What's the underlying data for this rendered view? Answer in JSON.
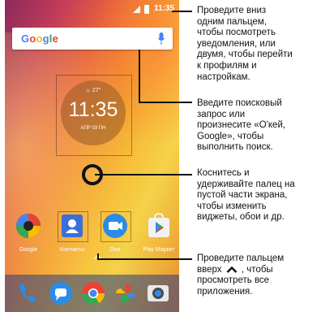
{
  "status": {
    "time": "11:35"
  },
  "search": {
    "logo": "Google"
  },
  "clock": {
    "weather": "☼ 27°",
    "time": "11:35",
    "date": "АПР  03  ПН"
  },
  "apps": [
    {
      "label": "Google"
    },
    {
      "label": "Контакты"
    },
    {
      "label": "Duo"
    },
    {
      "label": "Play Маркет"
    }
  ],
  "annotations": {
    "notifications": [
      "Проведите вниз",
      "одним пальцем,",
      "чтобы посмотреть",
      "уведомления, или",
      "двумя, чтобы перейти",
      "к профилям и",
      "настройкам."
    ],
    "search": [
      "Введите поисковый",
      "запрос или",
      "произнесите «О'кей,",
      "Google», чтобы",
      "выполнить поиск."
    ],
    "widgets": [
      "Коснитесь и",
      "удерживайте палец на",
      "пустой части экрана,",
      "чтобы изменить",
      "виджеты, обои и др."
    ],
    "apps": [
      "Проведите пальцем",
      "вверх",
      ", чтобы",
      "просмотреть все",
      "приложения."
    ]
  },
  "colors": {
    "google_blue": "#4285F4",
    "google_red": "#EA4335",
    "google_yellow": "#FBBC05",
    "google_green": "#34A853"
  }
}
